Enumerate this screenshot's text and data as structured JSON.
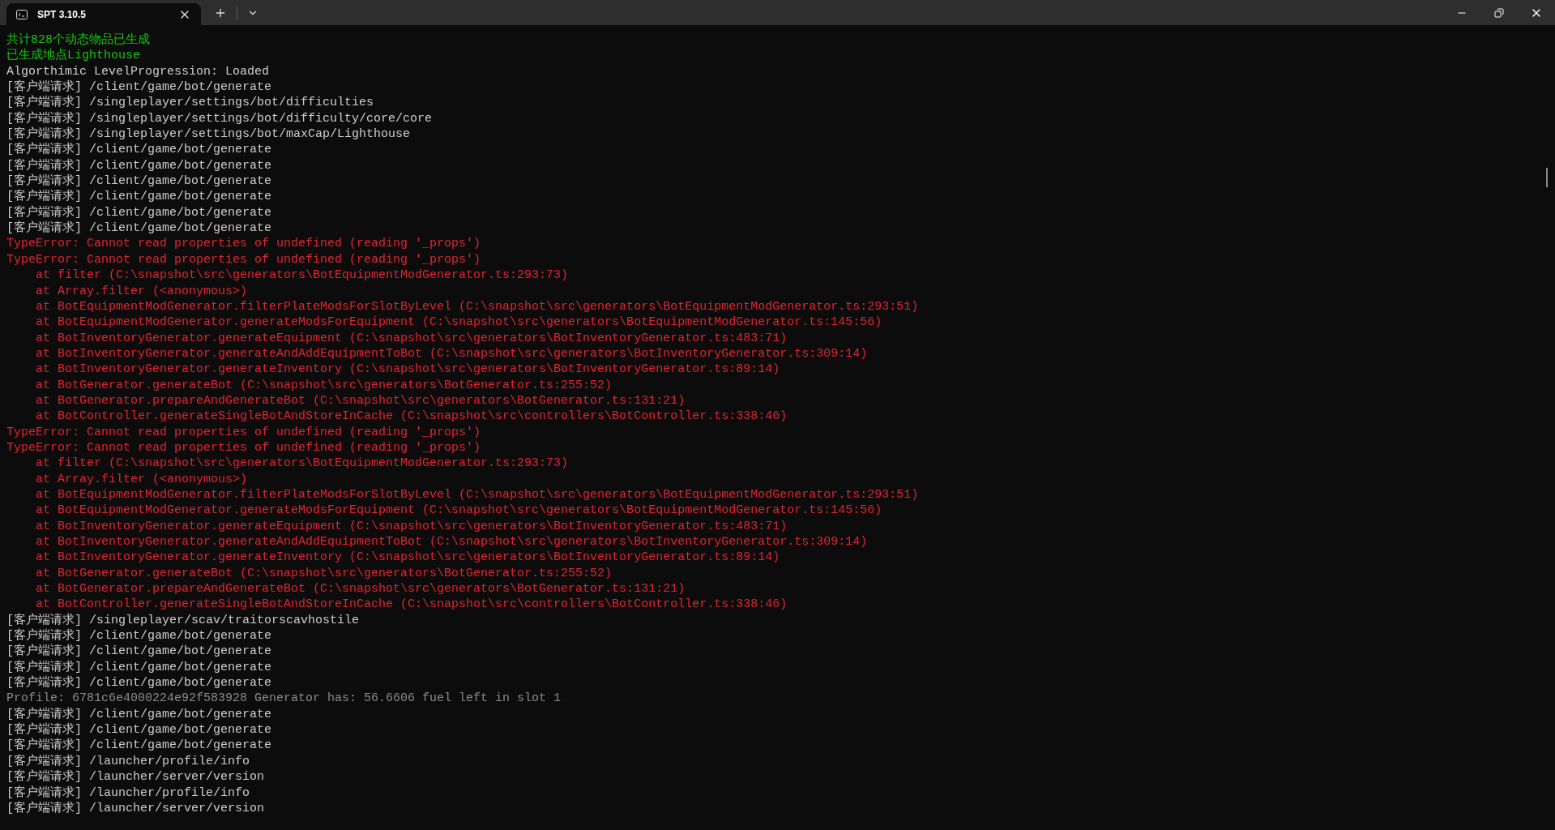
{
  "tab": {
    "title": "SPT 3.10.5",
    "selected": true
  },
  "lines": [
    {
      "kind": "success",
      "text": "共计828个动态物品已生成"
    },
    {
      "kind": "success",
      "text": "已生成地点Lighthouse"
    },
    {
      "kind": "info",
      "text": "Algorthimic LevelProgression: Loaded"
    },
    {
      "kind": "info",
      "text": "[客户端请求] /client/game/bot/generate"
    },
    {
      "kind": "info",
      "text": "[客户端请求] /singleplayer/settings/bot/difficulties"
    },
    {
      "kind": "info",
      "text": "[客户端请求] /singleplayer/settings/bot/difficulty/core/core"
    },
    {
      "kind": "info",
      "text": "[客户端请求] /singleplayer/settings/bot/maxCap/Lighthouse"
    },
    {
      "kind": "info",
      "text": "[客户端请求] /client/game/bot/generate"
    },
    {
      "kind": "info",
      "text": "[客户端请求] /client/game/bot/generate"
    },
    {
      "kind": "info",
      "text": "[客户端请求] /client/game/bot/generate"
    },
    {
      "kind": "info",
      "text": "[客户端请求] /client/game/bot/generate"
    },
    {
      "kind": "info",
      "text": "[客户端请求] /client/game/bot/generate"
    },
    {
      "kind": "info",
      "text": "[客户端请求] /client/game/bot/generate"
    },
    {
      "kind": "error",
      "text": "TypeError: Cannot read properties of undefined (reading '_props')"
    },
    {
      "kind": "error",
      "text": "TypeError: Cannot read properties of undefined (reading '_props')"
    },
    {
      "kind": "error",
      "text": "    at filter (C:\\snapshot\\src\\generators\\BotEquipmentModGenerator.ts:293:73)"
    },
    {
      "kind": "error",
      "text": "    at Array.filter (<anonymous>)"
    },
    {
      "kind": "error",
      "text": "    at BotEquipmentModGenerator.filterPlateModsForSlotByLevel (C:\\snapshot\\src\\generators\\BotEquipmentModGenerator.ts:293:51)"
    },
    {
      "kind": "error",
      "text": "    at BotEquipmentModGenerator.generateModsForEquipment (C:\\snapshot\\src\\generators\\BotEquipmentModGenerator.ts:145:56)"
    },
    {
      "kind": "error",
      "text": "    at BotInventoryGenerator.generateEquipment (C:\\snapshot\\src\\generators\\BotInventoryGenerator.ts:483:71)"
    },
    {
      "kind": "error",
      "text": "    at BotInventoryGenerator.generateAndAddEquipmentToBot (C:\\snapshot\\src\\generators\\BotInventoryGenerator.ts:309:14)"
    },
    {
      "kind": "error",
      "text": "    at BotInventoryGenerator.generateInventory (C:\\snapshot\\src\\generators\\BotInventoryGenerator.ts:89:14)"
    },
    {
      "kind": "error",
      "text": "    at BotGenerator.generateBot (C:\\snapshot\\src\\generators\\BotGenerator.ts:255:52)"
    },
    {
      "kind": "error",
      "text": "    at BotGenerator.prepareAndGenerateBot (C:\\snapshot\\src\\generators\\BotGenerator.ts:131:21)"
    },
    {
      "kind": "error",
      "text": "    at BotController.generateSingleBotAndStoreInCache (C:\\snapshot\\src\\controllers\\BotController.ts:338:46)"
    },
    {
      "kind": "error",
      "text": "TypeError: Cannot read properties of undefined (reading '_props')"
    },
    {
      "kind": "error",
      "text": "TypeError: Cannot read properties of undefined (reading '_props')"
    },
    {
      "kind": "error",
      "text": "    at filter (C:\\snapshot\\src\\generators\\BotEquipmentModGenerator.ts:293:73)"
    },
    {
      "kind": "error",
      "text": "    at Array.filter (<anonymous>)"
    },
    {
      "kind": "error",
      "text": "    at BotEquipmentModGenerator.filterPlateModsForSlotByLevel (C:\\snapshot\\src\\generators\\BotEquipmentModGenerator.ts:293:51)"
    },
    {
      "kind": "error",
      "text": "    at BotEquipmentModGenerator.generateModsForEquipment (C:\\snapshot\\src\\generators\\BotEquipmentModGenerator.ts:145:56)"
    },
    {
      "kind": "error",
      "text": "    at BotInventoryGenerator.generateEquipment (C:\\snapshot\\src\\generators\\BotInventoryGenerator.ts:483:71)"
    },
    {
      "kind": "error",
      "text": "    at BotInventoryGenerator.generateAndAddEquipmentToBot (C:\\snapshot\\src\\generators\\BotInventoryGenerator.ts:309:14)"
    },
    {
      "kind": "error",
      "text": "    at BotInventoryGenerator.generateInventory (C:\\snapshot\\src\\generators\\BotInventoryGenerator.ts:89:14)"
    },
    {
      "kind": "error",
      "text": "    at BotGenerator.generateBot (C:\\snapshot\\src\\generators\\BotGenerator.ts:255:52)"
    },
    {
      "kind": "error",
      "text": "    at BotGenerator.prepareAndGenerateBot (C:\\snapshot\\src\\generators\\BotGenerator.ts:131:21)"
    },
    {
      "kind": "error",
      "text": "    at BotController.generateSingleBotAndStoreInCache (C:\\snapshot\\src\\controllers\\BotController.ts:338:46)"
    },
    {
      "kind": "info",
      "text": "[客户端请求] /singleplayer/scav/traitorscavhostile"
    },
    {
      "kind": "info",
      "text": "[客户端请求] /client/game/bot/generate"
    },
    {
      "kind": "info",
      "text": "[客户端请求] /client/game/bot/generate"
    },
    {
      "kind": "info",
      "text": "[客户端请求] /client/game/bot/generate"
    },
    {
      "kind": "info",
      "text": "[客户端请求] /client/game/bot/generate"
    },
    {
      "kind": "debug",
      "text": "Profile: 6781c6e4000224e92f583928 Generator has: 56.6606 fuel left in slot 1"
    },
    {
      "kind": "info",
      "text": "[客户端请求] /client/game/bot/generate"
    },
    {
      "kind": "info",
      "text": "[客户端请求] /client/game/bot/generate"
    },
    {
      "kind": "info",
      "text": "[客户端请求] /client/game/bot/generate"
    },
    {
      "kind": "info",
      "text": "[客户端请求] /launcher/profile/info"
    },
    {
      "kind": "info",
      "text": "[客户端请求] /launcher/server/version"
    },
    {
      "kind": "info",
      "text": "[客户端请求] /launcher/profile/info"
    },
    {
      "kind": "info",
      "text": "[客户端请求] /launcher/server/version"
    }
  ]
}
